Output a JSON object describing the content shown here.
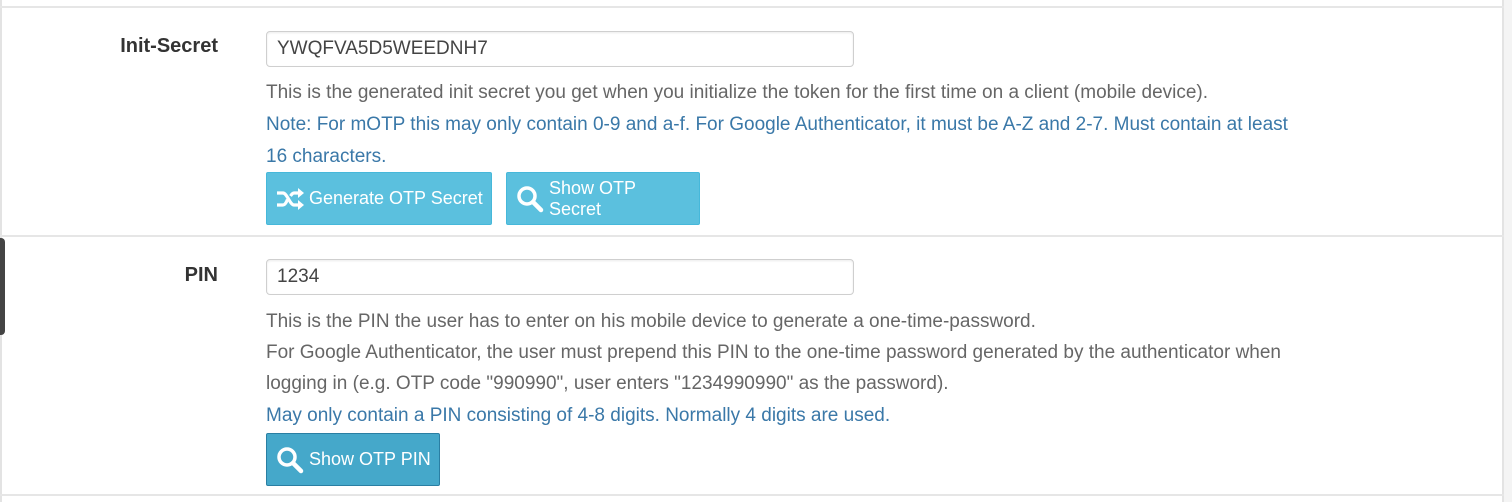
{
  "init_secret": {
    "label": "Init-Secret",
    "value": "YWQFVA5D5WEEDNH7",
    "help": "This is the generated init secret you get when you initialize the token for the first time on a client (mobile device).",
    "note_line1": "Note: For mOTP this may only contain 0-9 and a-f. For Google Authenticator, it must be A-Z and 2-7. Must contain at least",
    "note_line2": "16 characters.",
    "generate_button": "Generate OTP Secret",
    "show_button": "Show OTP Secret"
  },
  "pin": {
    "label": "PIN",
    "value": "1234",
    "help_line1": "This is the PIN the user has to enter on his mobile device to generate a one-time-password.",
    "help_line2": "For Google Authenticator, the user must prepend this PIN to the one-time password generated by the authenticator when",
    "help_line3": "logging in (e.g. OTP code \"990990\", user enters \"1234990990\" as the password).",
    "note": "May only contain a PIN consisting of 4-8 digits. Normally 4 digits are used.",
    "show_button": "Show OTP PIN"
  },
  "icons": {
    "generate": "random-icon",
    "show": "search-icon"
  },
  "colors": {
    "button": "#5bc0de",
    "button_active": "#45a8ca",
    "note_text": "#3a78a8",
    "help_text": "#666666"
  }
}
